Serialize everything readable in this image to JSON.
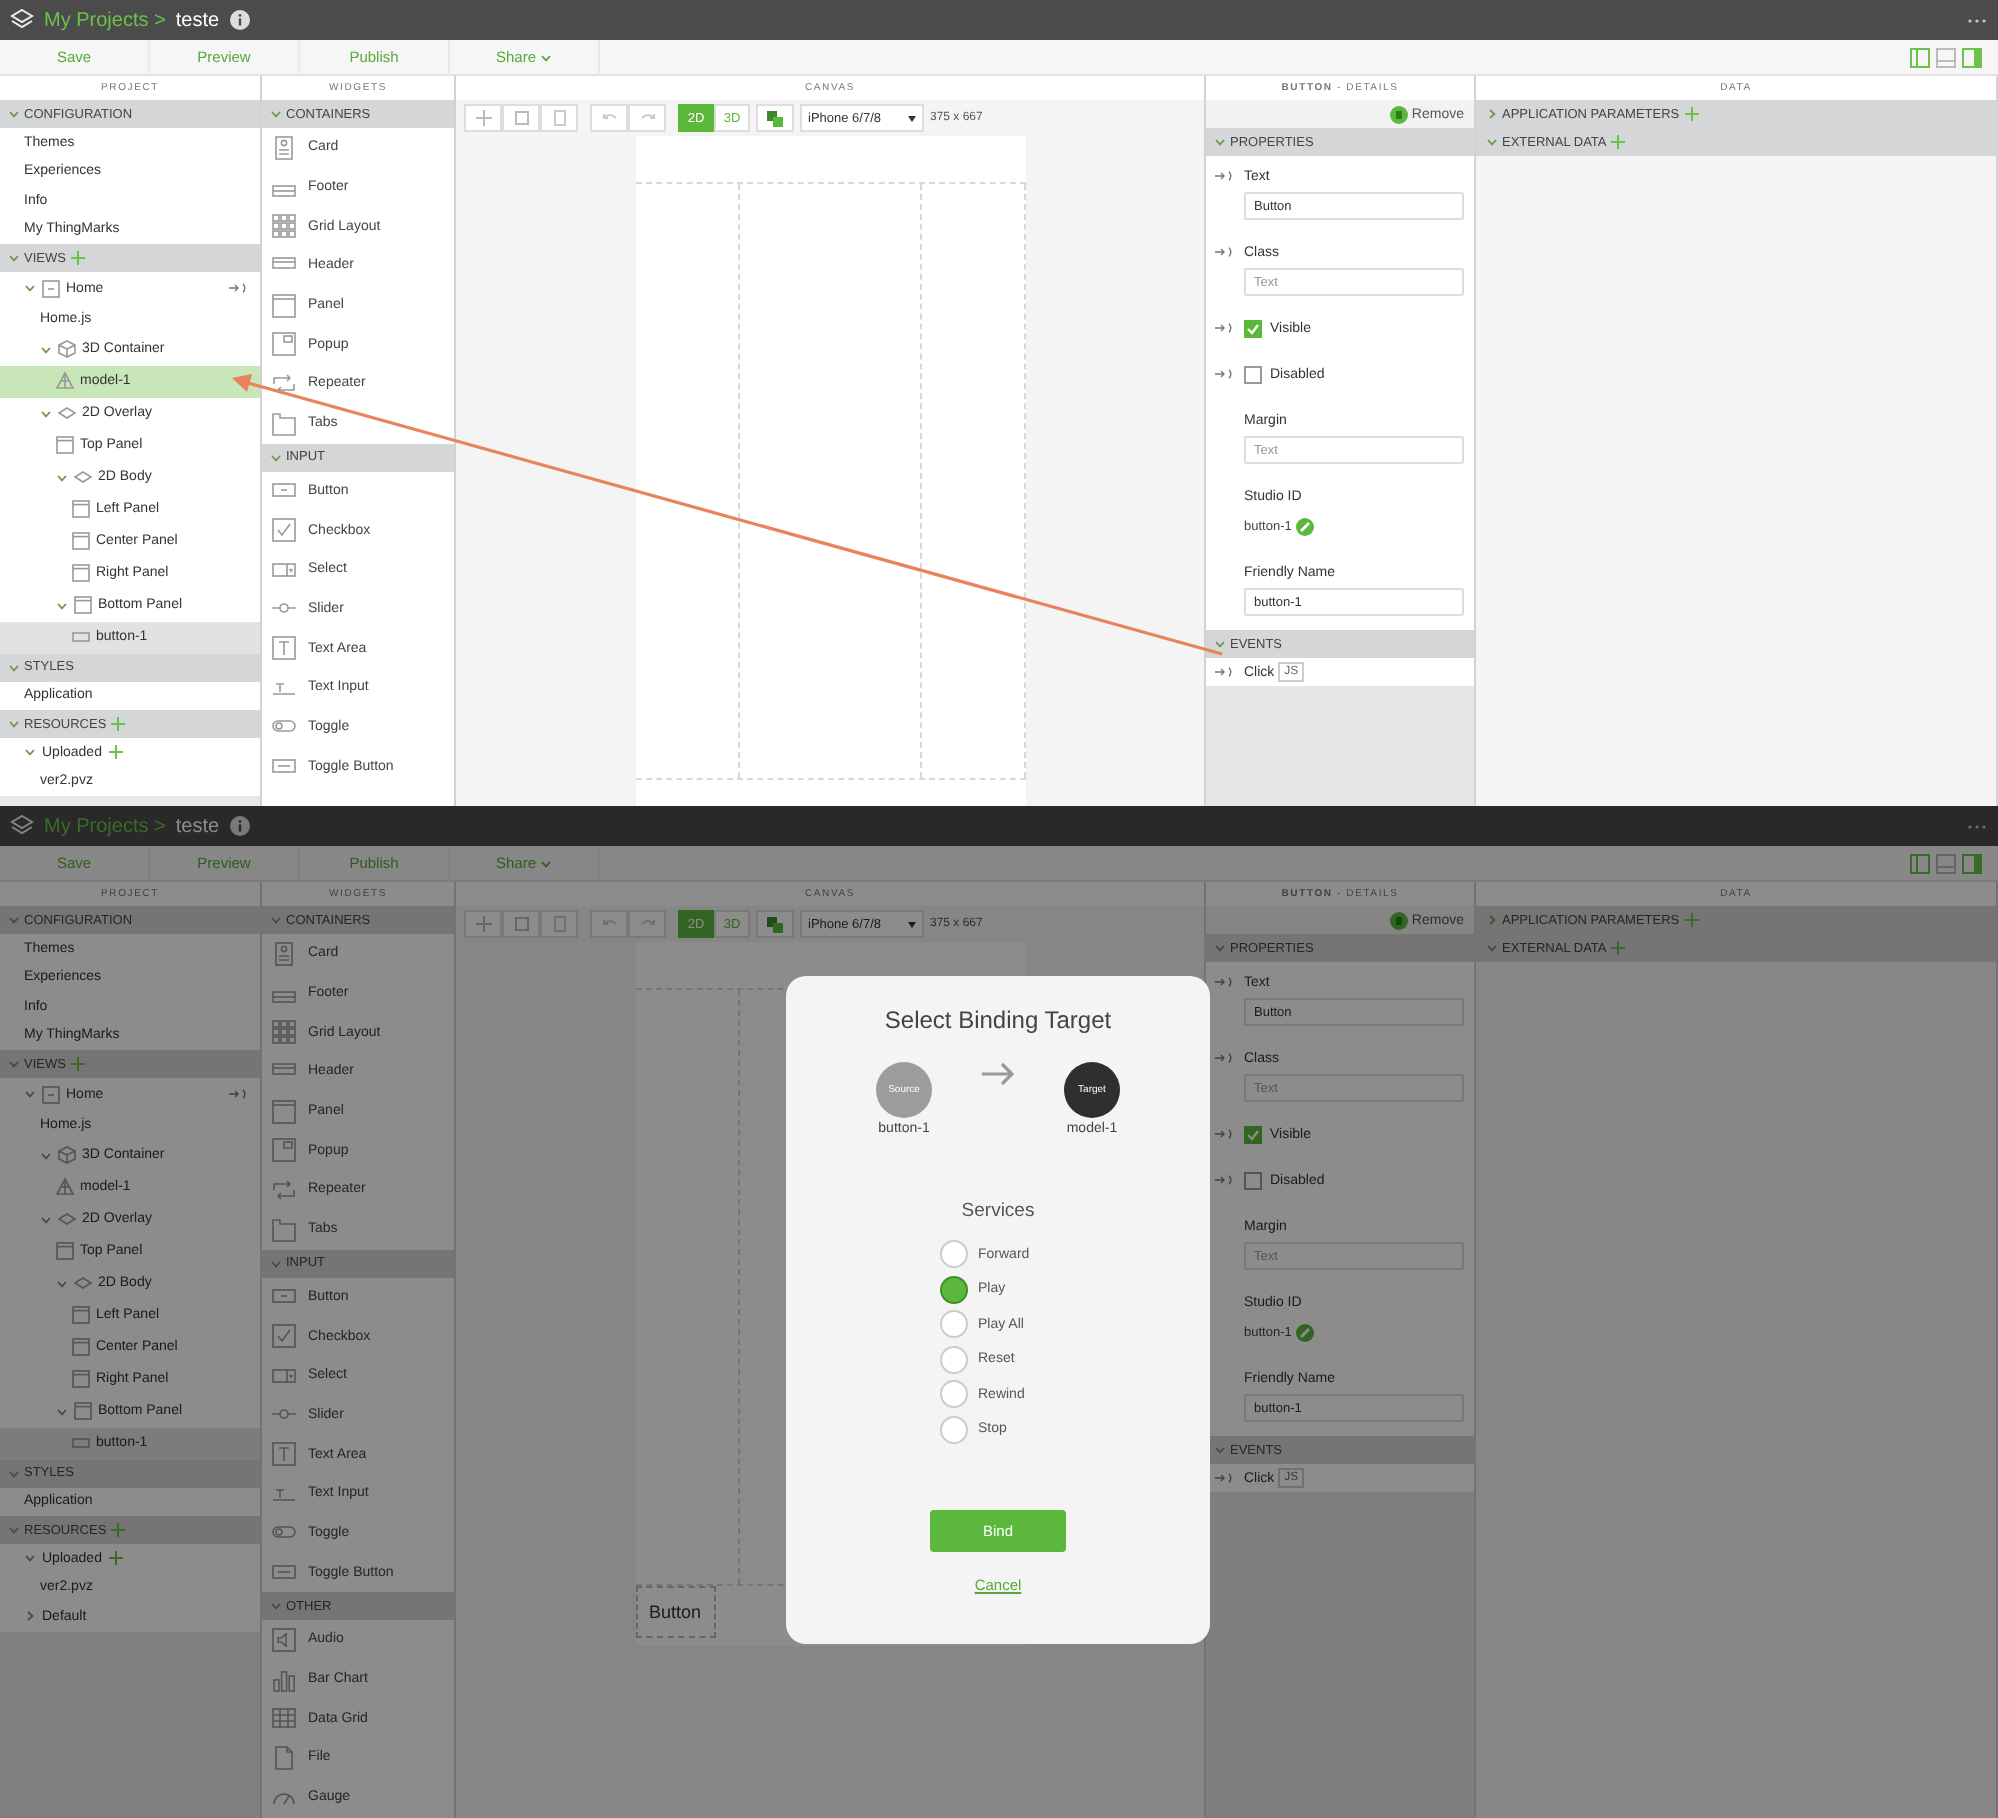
{
  "screens": [
    {
      "binding_drag": true,
      "top_bar": {
        "breadcrumb": "My Projects >",
        "project": "teste"
      },
      "toolbar": [
        {
          "label": "Save",
          "menu": false
        },
        {
          "label": "Preview",
          "menu": false
        },
        {
          "label": "Publish",
          "menu": false
        },
        {
          "label": "Share",
          "menu": true
        }
      ],
      "project": {
        "title": "PROJECT",
        "sections": [
          {
            "title": "CONFIGURATION",
            "addable": false,
            "items": [
              {
                "label": "Themes",
                "selected": false,
                "drop_target": false
              },
              {
                "label": "Experiences",
                "selected": false,
                "drop_target": false
              },
              {
                "label": "Info",
                "selected": false,
                "drop_target": false
              },
              {
                "label": "My ThingMarks",
                "selected": false,
                "drop_target": false
              }
            ]
          },
          {
            "title": "VIEWS",
            "addable": true,
            "items": [
              {
                "label": "Home",
                "kind": "view",
                "expanded": true,
                "bindable": true,
                "selected": false,
                "drop_target": false,
                "children": [
                  {
                    "label": "Home.js",
                    "selected": false,
                    "drop_target": false
                  },
                  {
                    "label": "3D Container",
                    "kind": "container",
                    "expanded": true,
                    "selected": false,
                    "drop_target": false,
                    "children": [
                      {
                        "label": "model-1",
                        "kind": "model",
                        "selected": false,
                        "drop_target": true
                      }
                    ]
                  },
                  {
                    "label": "2D Overlay",
                    "kind": "overlay",
                    "expanded": true,
                    "selected": false,
                    "drop_target": false,
                    "children": [
                      {
                        "label": "Top Panel",
                        "kind": "panel",
                        "selected": false,
                        "drop_target": false
                      },
                      {
                        "label": "2D Body",
                        "kind": "overlay",
                        "expanded": true,
                        "selected": false,
                        "drop_target": false,
                        "children": [
                          {
                            "label": "Left Panel",
                            "kind": "panel",
                            "selected": false,
                            "drop_target": false
                          },
                          {
                            "label": "Center Panel",
                            "kind": "panel",
                            "selected": false,
                            "drop_target": false
                          },
                          {
                            "label": "Right Panel",
                            "kind": "panel",
                            "selected": false,
                            "drop_target": false
                          }
                        ]
                      },
                      {
                        "label": "Bottom Panel",
                        "kind": "panel",
                        "expanded": true,
                        "selected": false,
                        "drop_target": false,
                        "children": [
                          {
                            "label": "button-1",
                            "kind": "button",
                            "selected": true,
                            "drop_target": false
                          }
                        ]
                      }
                    ]
                  }
                ]
              }
            ]
          },
          {
            "title": "STYLES",
            "addable": false,
            "items": [
              {
                "label": "Application",
                "selected": false,
                "drop_target": false
              }
            ]
          },
          {
            "title": "RESOURCES",
            "addable": true,
            "items": [
              {
                "label": "Uploaded",
                "expanded": true,
                "addable": true,
                "selected": false,
                "drop_target": false,
                "children": [
                  {
                    "label": "ver2.pvz",
                    "selected": false,
                    "drop_target": false
                  }
                ]
              }
            ]
          }
        ]
      },
      "widgets": {
        "title": "WIDGETS",
        "sections": [
          {
            "title": "CONTAINERS",
            "items": [
              {
                "label": "Card",
                "kind": "card"
              },
              {
                "label": "Footer",
                "kind": "footer"
              },
              {
                "label": "Grid Layout",
                "kind": "grid"
              },
              {
                "label": "Header",
                "kind": "header"
              },
              {
                "label": "Panel",
                "kind": "panel"
              },
              {
                "label": "Popup",
                "kind": "popup"
              },
              {
                "label": "Repeater",
                "kind": "repeater"
              },
              {
                "label": "Tabs",
                "kind": "tabs"
              }
            ]
          },
          {
            "title": "INPUT",
            "items": [
              {
                "label": "Button",
                "kind": "button"
              },
              {
                "label": "Checkbox",
                "kind": "checkbox"
              },
              {
                "label": "Select",
                "kind": "select"
              },
              {
                "label": "Slider",
                "kind": "slider"
              },
              {
                "label": "Text Area",
                "kind": "textarea"
              },
              {
                "label": "Text Input",
                "kind": "textinput"
              },
              {
                "label": "Toggle",
                "kind": "toggle"
              },
              {
                "label": "Toggle Button",
                "kind": "togglebutton"
              }
            ]
          }
        ]
      },
      "canvas": {
        "title": "CANVAS",
        "modes": [
          {
            "label": "2D",
            "selected": true
          },
          {
            "label": "3D",
            "selected": false
          }
        ],
        "device": "iPhone 6/7/8",
        "size": "375 x 667"
      },
      "details": {
        "title": "**BUTTON** - DETAILS",
        "remove": "Remove",
        "sections": [
          {
            "title": "PROPERTIES",
            "fields": [
              {
                "kind": "text",
                "label": "Text",
                "bindable": true,
                "value": "Button"
              },
              {
                "kind": "text",
                "label": "Class",
                "bindable": true,
                "placeholder": "Text"
              },
              {
                "kind": "checkbox",
                "label": "Visible",
                "bindable": true,
                "checked": true
              },
              {
                "kind": "checkbox",
                "label": "Disabled",
                "bindable": true,
                "checked": false
              },
              {
                "kind": "text",
                "label": "Margin",
                "bindable": false,
                "placeholder": "Text"
              },
              {
                "kind": "id",
                "label": "Studio ID",
                "value": "button-1"
              },
              {
                "kind": "text",
                "label": "Friendly Name",
                "bindable": false,
                "value": "button-1"
              }
            ]
          },
          {
            "title": "EVENTS",
            "fields": [
              {
                "kind": "event",
                "label": "Click",
                "bindable": true,
                "badge": "JS"
              }
            ]
          }
        ]
      },
      "data": {
        "title": "DATA",
        "sections": [
          {
            "title": "APPLICATION PARAMETERS",
            "expanded": false,
            "addable": true
          },
          {
            "title": "EXTERNAL DATA",
            "expanded": true,
            "addable": true
          }
        ]
      }
    },
    {
      "binding_drag": false,
      "top_bar": {
        "breadcrumb": "My Projects >",
        "project": "teste"
      },
      "toolbar": [
        {
          "label": "Save",
          "menu": false
        },
        {
          "label": "Preview",
          "menu": false
        },
        {
          "label": "Publish",
          "menu": false
        },
        {
          "label": "Share",
          "menu": true
        }
      ],
      "project": {
        "title": "PROJECT",
        "sections": [
          {
            "title": "CONFIGURATION",
            "addable": false,
            "items": [
              {
                "label": "Themes",
                "selected": false,
                "drop_target": false
              },
              {
                "label": "Experiences",
                "selected": false,
                "drop_target": false
              },
              {
                "label": "Info",
                "selected": false,
                "drop_target": false
              },
              {
                "label": "My ThingMarks",
                "selected": false,
                "drop_target": false
              }
            ]
          },
          {
            "title": "VIEWS",
            "addable": true,
            "items": [
              {
                "label": "Home",
                "kind": "view",
                "expanded": true,
                "bindable": true,
                "selected": false,
                "drop_target": false,
                "children": [
                  {
                    "label": "Home.js",
                    "selected": false,
                    "drop_target": false
                  },
                  {
                    "label": "3D Container",
                    "kind": "container",
                    "expanded": true,
                    "selected": false,
                    "drop_target": false,
                    "children": [
                      {
                        "label": "model-1",
                        "kind": "model",
                        "selected": false,
                        "drop_target": false
                      }
                    ]
                  },
                  {
                    "label": "2D Overlay",
                    "kind": "overlay",
                    "expanded": true,
                    "selected": false,
                    "drop_target": false,
                    "children": [
                      {
                        "label": "Top Panel",
                        "kind": "panel",
                        "selected": false,
                        "drop_target": false
                      },
                      {
                        "label": "2D Body",
                        "kind": "overlay",
                        "expanded": true,
                        "selected": false,
                        "drop_target": false,
                        "children": [
                          {
                            "label": "Left Panel",
                            "kind": "panel",
                            "selected": false,
                            "drop_target": false
                          },
                          {
                            "label": "Center Panel",
                            "kind": "panel",
                            "selected": false,
                            "drop_target": false
                          },
                          {
                            "label": "Right Panel",
                            "kind": "panel",
                            "selected": false,
                            "drop_target": false
                          }
                        ]
                      },
                      {
                        "label": "Bottom Panel",
                        "kind": "panel",
                        "expanded": true,
                        "selected": false,
                        "drop_target": false,
                        "children": [
                          {
                            "label": "button-1",
                            "kind": "button",
                            "selected": true,
                            "drop_target": false
                          }
                        ]
                      }
                    ]
                  }
                ]
              }
            ]
          },
          {
            "title": "STYLES",
            "addable": false,
            "items": [
              {
                "label": "Application",
                "selected": false,
                "drop_target": false
              }
            ]
          },
          {
            "title": "RESOURCES",
            "addable": true,
            "items": [
              {
                "label": "Uploaded",
                "expanded": true,
                "addable": true,
                "selected": false,
                "drop_target": false,
                "children": [
                  {
                    "label": "ver2.pvz",
                    "selected": false,
                    "drop_target": false
                  }
                ]
              },
              {
                "label": "Default",
                "expanded": false,
                "selected": false,
                "drop_target": false
              }
            ]
          }
        ]
      },
      "widgets": {
        "title": "WIDGETS",
        "sections": [
          {
            "title": "CONTAINERS",
            "items": [
              {
                "label": "Card",
                "kind": "card"
              },
              {
                "label": "Footer",
                "kind": "footer"
              },
              {
                "label": "Grid Layout",
                "kind": "grid"
              },
              {
                "label": "Header",
                "kind": "header"
              },
              {
                "label": "Panel",
                "kind": "panel"
              },
              {
                "label": "Popup",
                "kind": "popup"
              },
              {
                "label": "Repeater",
                "kind": "repeater"
              },
              {
                "label": "Tabs",
                "kind": "tabs"
              }
            ]
          },
          {
            "title": "INPUT",
            "items": [
              {
                "label": "Button",
                "kind": "button"
              },
              {
                "label": "Checkbox",
                "kind": "checkbox"
              },
              {
                "label": "Select",
                "kind": "select"
              },
              {
                "label": "Slider",
                "kind": "slider"
              },
              {
                "label": "Text Area",
                "kind": "textarea"
              },
              {
                "label": "Text Input",
                "kind": "textinput"
              },
              {
                "label": "Toggle",
                "kind": "toggle"
              },
              {
                "label": "Toggle Button",
                "kind": "togglebutton"
              }
            ]
          },
          {
            "title": "OTHER",
            "items": [
              {
                "label": "Audio",
                "kind": "audio"
              },
              {
                "label": "Bar Chart",
                "kind": "barchart"
              },
              {
                "label": "Data Grid",
                "kind": "datagrid"
              },
              {
                "label": "File",
                "kind": "file"
              },
              {
                "label": "Gauge",
                "kind": "gauge"
              }
            ]
          }
        ]
      },
      "canvas": {
        "title": "CANVAS",
        "modes": [
          {
            "label": "2D",
            "selected": true
          },
          {
            "label": "3D",
            "selected": false
          }
        ],
        "device": "iPhone 6/7/8",
        "size": "375 x 667",
        "button_label": "Button"
      },
      "details": {
        "title": "**BUTTON** - DETAILS",
        "remove": "Remove",
        "sections": [
          {
            "title": "PROPERTIES",
            "fields": [
              {
                "kind": "text",
                "label": "Text",
                "bindable": true,
                "value": "Button"
              },
              {
                "kind": "text",
                "label": "Class",
                "bindable": true,
                "placeholder": "Text"
              },
              {
                "kind": "checkbox",
                "label": "Visible",
                "bindable": true,
                "checked": true
              },
              {
                "kind": "checkbox",
                "label": "Disabled",
                "bindable": true,
                "checked": false
              },
              {
                "kind": "text",
                "label": "Margin",
                "bindable": false,
                "placeholder": "Text"
              },
              {
                "kind": "id",
                "label": "Studio ID",
                "value": "button-1"
              },
              {
                "kind": "text",
                "label": "Friendly Name",
                "bindable": false,
                "value": "button-1"
              }
            ]
          },
          {
            "title": "EVENTS",
            "fields": [
              {
                "kind": "event",
                "label": "Click",
                "bindable": true,
                "badge": "JS"
              }
            ]
          }
        ]
      },
      "data": {
        "title": "DATA",
        "sections": [
          {
            "title": "APPLICATION PARAMETERS",
            "expanded": false,
            "addable": true
          },
          {
            "title": "EXTERNAL DATA",
            "expanded": true,
            "addable": true
          }
        ]
      },
      "modal": {
        "title": "Select Binding Target",
        "source": {
          "badge": "Source",
          "name": "button-1"
        },
        "target": {
          "badge": "Target",
          "name": "model-1"
        },
        "services_title": "Services",
        "services": [
          {
            "label": "Forward",
            "selected": false
          },
          {
            "label": "Play",
            "selected": true
          },
          {
            "label": "Play All",
            "selected": false
          },
          {
            "label": "Reset",
            "selected": false
          },
          {
            "label": "Rewind",
            "selected": false
          },
          {
            "label": "Stop",
            "selected": false
          }
        ],
        "bind": "Bind",
        "cancel": "Cancel"
      }
    }
  ]
}
